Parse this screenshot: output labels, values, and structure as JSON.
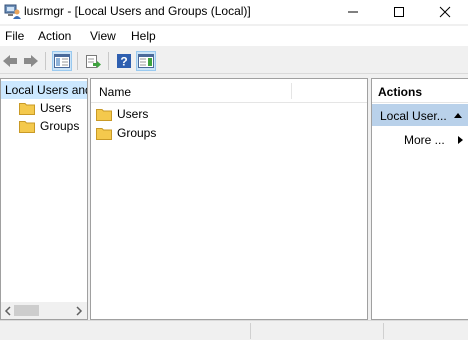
{
  "window": {
    "title": "lusrmgr - [Local Users and Groups (Local)]",
    "controls": {
      "minimize": "minimize-icon",
      "maximize": "maximize-icon",
      "close": "close-icon"
    }
  },
  "menu": [
    "File",
    "Action",
    "View",
    "Help"
  ],
  "toolbar": {
    "buttons": [
      "back-arrow-icon",
      "forward-arrow-icon",
      "show-hide-console-tree-icon",
      "export-list-icon",
      "help-icon",
      "show-hide-action-pane-icon"
    ]
  },
  "tree": {
    "root": "Local Users and Groups (Local)",
    "children": [
      "Users",
      "Groups"
    ]
  },
  "list": {
    "column": "Name",
    "items": [
      "Users",
      "Groups"
    ]
  },
  "actions": {
    "header": "Actions",
    "group": "Local User...",
    "more": "More ..."
  },
  "colors": {
    "selection": "#cce8ff",
    "action_group": "#b9d1ea",
    "folder": "#f4c94d"
  }
}
